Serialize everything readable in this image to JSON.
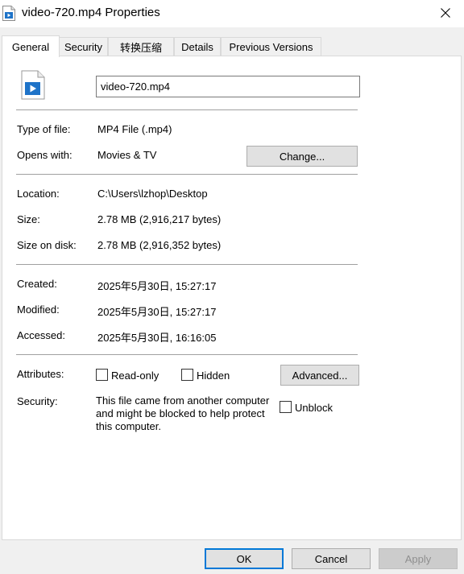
{
  "window": {
    "title": "video-720.mp4 Properties",
    "close_icon": "close-icon"
  },
  "tabs": [
    {
      "label": "General",
      "active": true
    },
    {
      "label": "Security",
      "active": false
    },
    {
      "label": "转换压缩",
      "active": false
    },
    {
      "label": "Details",
      "active": false
    },
    {
      "label": "Previous Versions",
      "active": false
    }
  ],
  "general": {
    "file_name": "video-720.mp4",
    "file_icon": "video-file-icon",
    "type_label": "Type of file:",
    "type_value": "MP4 File (.mp4)",
    "opens_label": "Opens with:",
    "opens_value": "Movies & TV",
    "change_button": "Change...",
    "location_label": "Location:",
    "location_value": "C:\\Users\\lzhop\\Desktop",
    "size_label": "Size:",
    "size_value": "2.78 MB (2,916,217 bytes)",
    "size_disk_label": "Size on disk:",
    "size_disk_value": "2.78 MB (2,916,352 bytes)",
    "created_label": "Created:",
    "created_value": "2025年5月30日, 15:27:17",
    "modified_label": "Modified:",
    "modified_value": "2025年5月30日, 15:27:17",
    "accessed_label": "Accessed:",
    "accessed_value": "2025年5月30日, 16:16:05",
    "attributes_label": "Attributes:",
    "readonly_label": "Read-only",
    "readonly_checked": false,
    "hidden_label": "Hidden",
    "hidden_checked": false,
    "advanced_button": "Advanced...",
    "security_label": "Security:",
    "security_lines": [
      "This file came from another computer",
      "and might be blocked to help protect",
      "this computer."
    ],
    "unblock_label": "Unblock",
    "unblock_checked": false
  },
  "footer": {
    "ok": "OK",
    "cancel": "Cancel",
    "apply": "Apply"
  },
  "colors": {
    "accent": "#0078d7",
    "panel": "#ffffff",
    "window": "#f0f0f0"
  }
}
